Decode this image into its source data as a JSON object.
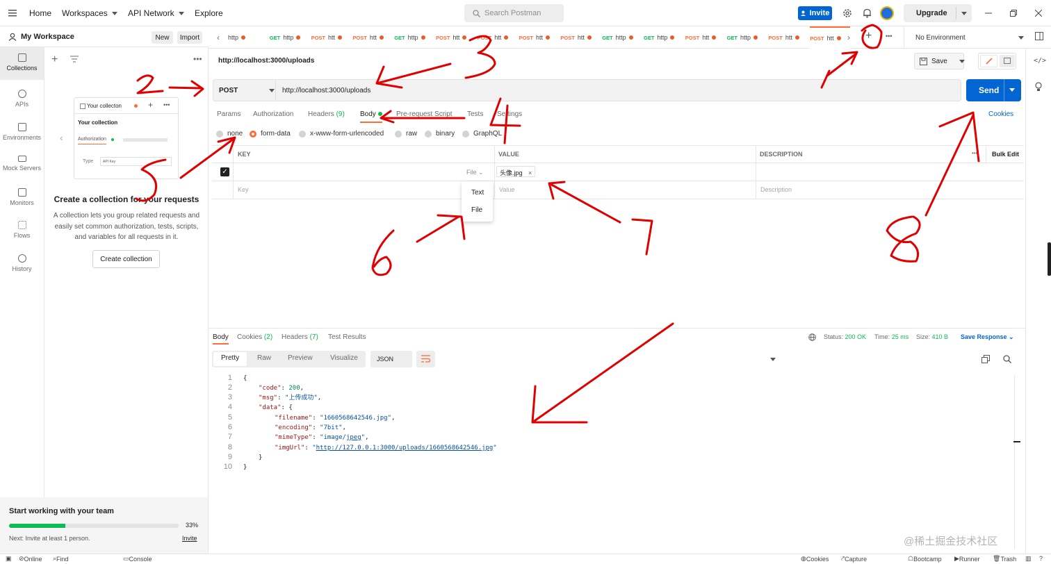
{
  "topbar": {
    "menu_icon": "hamburger-icon",
    "home": "Home",
    "workspaces": "Workspaces",
    "api_network": "API Network",
    "explore": "Explore",
    "search_placeholder": "Search Postman",
    "invite": "Invite",
    "upgrade": "Upgrade"
  },
  "workspace": {
    "name": "My Workspace",
    "new_label": "New",
    "import_label": "Import"
  },
  "rail": [
    {
      "label": "Collections",
      "icon": "collections-icon"
    },
    {
      "label": "APIs",
      "icon": "apis-icon"
    },
    {
      "label": "Environments",
      "icon": "environments-icon"
    },
    {
      "label": "Mock Servers",
      "icon": "mock-servers-icon"
    },
    {
      "label": "Monitors",
      "icon": "monitors-icon"
    },
    {
      "label": "Flows",
      "icon": "flows-icon"
    },
    {
      "label": "History",
      "icon": "history-icon"
    }
  ],
  "collections_panel": {
    "card_title": "Your collecton",
    "card_heading": "Your collection",
    "card_tab": "Authorization",
    "card_type_label": "Type",
    "card_type_value": "API Key",
    "empty_title": "Create a collection for your requests",
    "empty_desc_1": "A collection lets you group related requests and",
    "empty_desc_2": "easily set common authorization, tests, scripts,",
    "empty_desc_3": "and variables for all requests in it.",
    "create_button": "Create collection"
  },
  "team": {
    "title": "Start working with your team",
    "progress_percent": 33,
    "progress_label": "33%",
    "next_text": "Next: Invite at least 1 person.",
    "invite_link": "Invite"
  },
  "tabs": [
    {
      "method": "",
      "label": "http",
      "color": "#212121"
    },
    {
      "method": "GET",
      "label": "http",
      "color": "#0cbb52"
    },
    {
      "method": "POST",
      "label": "htt",
      "color": "#ff6c37"
    },
    {
      "method": "POST",
      "label": "htt",
      "color": "#ff6c37"
    },
    {
      "method": "GET",
      "label": "http",
      "color": "#0cbb52"
    },
    {
      "method": "POST",
      "label": "htt",
      "color": "#ff6c37"
    },
    {
      "method": "POST",
      "label": "htt",
      "color": "#ff6c37"
    },
    {
      "method": "POST",
      "label": "htt",
      "color": "#ff6c37"
    },
    {
      "method": "POST",
      "label": "htt",
      "color": "#ff6c37"
    },
    {
      "method": "GET",
      "label": "http",
      "color": "#0cbb52"
    },
    {
      "method": "GET",
      "label": "http",
      "color": "#0cbb52"
    },
    {
      "method": "POST",
      "label": "htt",
      "color": "#ff6c37"
    },
    {
      "method": "GET",
      "label": "http",
      "color": "#0cbb52"
    },
    {
      "method": "POST",
      "label": "htt",
      "color": "#ff6c37"
    },
    {
      "method": "POST",
      "label": "htt",
      "color": "#ff6c37"
    }
  ],
  "environment": "No Environment",
  "request": {
    "title": "http://localhost:3000/uploads",
    "save": "Save",
    "method": "POST",
    "url": "http://localhost:3000/uploads",
    "send": "Send",
    "cookies": "Cookies",
    "subtabs": {
      "params": "Params",
      "authorization": "Authorization",
      "headers": "Headers",
      "headers_count": "(9)",
      "body": "Body",
      "pre_request": "Pre-request Script",
      "tests": "Tests",
      "settings": "Settings"
    },
    "body_types": [
      "none",
      "form-data",
      "x-www-form-urlencoded",
      "raw",
      "binary",
      "GraphQL"
    ],
    "body_type_selected": "form-data",
    "table": {
      "key_header": "KEY",
      "value_header": "VALUE",
      "description_header": "DESCRIPTION",
      "bulk_edit": "Bulk Edit",
      "row_type": "File",
      "row_value": "头像.jpg",
      "key_placeholder": "Key",
      "value_placeholder": "Value",
      "description_placeholder": "Description"
    },
    "type_dropdown": [
      "Text",
      "File"
    ]
  },
  "response": {
    "tabs": {
      "body": "Body",
      "cookies": "Cookies",
      "cookies_count": "(2)",
      "headers": "Headers",
      "headers_count": "(7)",
      "test_results": "Test Results"
    },
    "status_label": "Status:",
    "status_value": "200 OK",
    "time_label": "Time:",
    "time_value": "25 ms",
    "size_label": "Size:",
    "size_value": "410 B",
    "save_response": "Save Response",
    "modes": [
      "Pretty",
      "Raw",
      "Preview",
      "Visualize"
    ],
    "format": "JSON",
    "line_numbers": [
      "1",
      "2",
      "3",
      "4",
      "5",
      "6",
      "7",
      "8",
      "9",
      "10"
    ],
    "code": {
      "open": "{",
      "code_key": "\"code\"",
      "code_val": "200",
      "msg_key": "\"msg\"",
      "msg_val": "\"上传成功\"",
      "data_key": "\"data\"",
      "filename_key": "\"filename\"",
      "filename_val": "\"1660568642546.jpg\"",
      "encoding_key": "\"encoding\"",
      "encoding_val": "\"7bit\"",
      "mimetype_key": "\"mimeType\"",
      "mimetype_val_a": "\"image/",
      "mimetype_val_b": "jpeg",
      "mimetype_val_c": "\"",
      "imgurl_key": "\"imgUrl\"",
      "imgurl_val": "http://127.0.0.1:3000/uploads/1660568642546.jpg",
      "inner_close": "}",
      "close": "}"
    }
  },
  "statusbar": {
    "online": "Online",
    "find_replace": "Find and Replace",
    "console": "Console",
    "cookies": "Cookies",
    "capture": "Capture requests",
    "bootcamp": "Bootcamp",
    "runner": "Runner",
    "trash": "Trash"
  },
  "watermark": "@稀土掘金技术社区",
  "annotations": [
    "1",
    "2",
    "3",
    "4",
    "5",
    "6",
    "7",
    "8"
  ],
  "colors": {
    "accent": "#ff6c37",
    "primary": "#0265d2",
    "success": "#0cbb52",
    "annotation": "#e00000"
  }
}
